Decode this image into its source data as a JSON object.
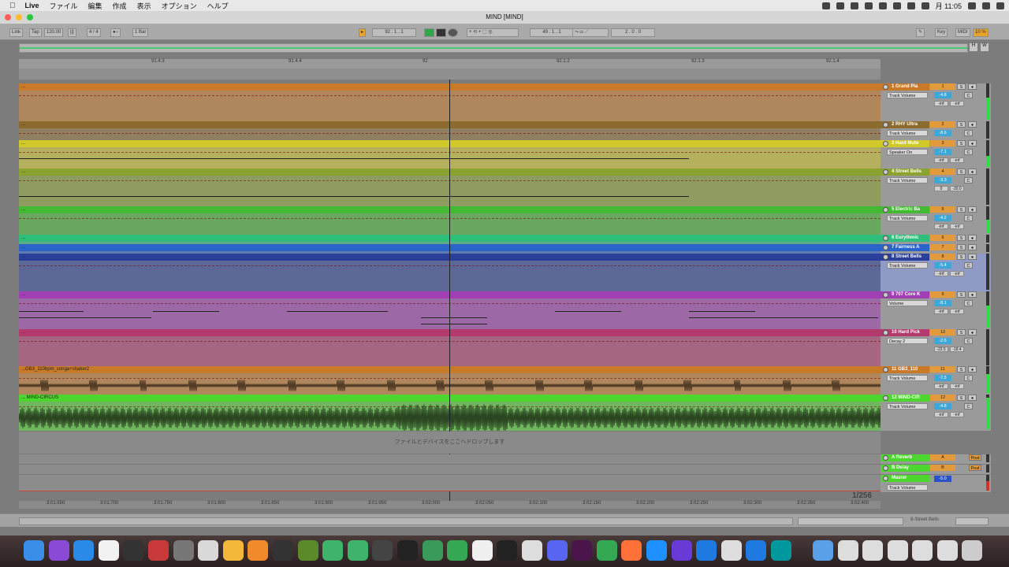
{
  "menubar": {
    "app": "Live",
    "items": [
      "ファイル",
      "編集",
      "作成",
      "表示",
      "オプション",
      "ヘルプ"
    ],
    "clock": "月 11:05"
  },
  "window": {
    "title": "MIND  [MIND]"
  },
  "controlbar": {
    "link": "Link",
    "tap": "Tap",
    "tempo": "120.00",
    "signature": "4 / 4",
    "quant": "1 Bar",
    "pos": "92 . 1 . 1",
    "loop_start": "49 . 1 . 1",
    "loop_len": "2 . 0 . 0",
    "key": "Key",
    "midi": "MIDI",
    "cpu": "10 %"
  },
  "ruler": {
    "ticks": [
      "91.4.3",
      "91.4.4",
      "92",
      "92.1.2",
      "92.1.3",
      "92.1.4"
    ]
  },
  "colors": {
    "accent_select": "#2a52c8",
    "meter": "#2edc46",
    "volume_field": "#3da8d8"
  },
  "tracks": [
    {
      "name": "1 Grand Pia",
      "num": "1",
      "chooser": "Track Volume",
      "vol": "-4.8",
      "inf1": "-inf",
      "inf2": "-inf",
      "color": "#c97a28",
      "clip": "...",
      "level": 0.6
    },
    {
      "name": "2 RHY Ultra",
      "num": "2",
      "chooser": "Track Volume",
      "vol": "-8.6",
      "inf1": "",
      "inf2": "",
      "color": "#8c6b2f",
      "clip": "...",
      "level": 0.0
    },
    {
      "name": "3 Hard Mute",
      "num": "3",
      "chooser": "Speaker On",
      "vol": "-7.1",
      "inf1": "-inf",
      "inf2": "-inf",
      "color": "#d1c92a",
      "clip": "...",
      "level": 0.4
    },
    {
      "name": "4 Street Bells",
      "num": "4",
      "chooser": "Track Volume",
      "vol": "-3.3",
      "inf1": "0",
      "inf2": "-20.0",
      "color": "#8aa230",
      "clip": "...",
      "level": 0.0
    },
    {
      "name": "5 Electric Ba",
      "num": "5",
      "chooser": "Track Volume",
      "vol": "-4.2",
      "inf1": "-inf",
      "inf2": "-inf",
      "color": "#44b933",
      "clip": "...",
      "level": 0.5
    },
    {
      "name": "6 Eurythmic",
      "num": "6",
      "chooser": "",
      "vol": "",
      "inf1": "",
      "inf2": "",
      "color": "#2fbf7c",
      "clip": "...",
      "level": 0.0
    },
    {
      "name": "7 Fairness A",
      "num": "7",
      "chooser": "",
      "vol": "",
      "inf1": "",
      "inf2": "",
      "color": "#2a64c8",
      "clip": "...",
      "level": 0.0
    },
    {
      "name": "8 Street Bells",
      "num": "8",
      "chooser": "Track Volume",
      "vol": "-5.4",
      "inf1": "-inf",
      "inf2": "-inf",
      "color": "#2a3f9a",
      "clip": "...",
      "level": 0.0
    },
    {
      "name": "9 707 Core K",
      "num": "9",
      "chooser": "Volume",
      "vol": "-8.1",
      "inf1": "-inf",
      "inf2": "-inf",
      "color": "#a23fb4",
      "clip": "...",
      "level": 0.6
    },
    {
      "name": "10 Hard Pick",
      "num": "10",
      "chooser": "Decay 2",
      "vol": "-2.6",
      "inf1": "-22.5",
      "inf2": "-18.4",
      "color": "#b43a6e",
      "clip": "...",
      "level": 0.0
    },
    {
      "name": "11 GB3_110",
      "num": "11",
      "chooser": "Track Volume",
      "vol": "-7.5",
      "inf1": "-inf",
      "inf2": "-inf",
      "color": "#c97a28",
      "clip": "...GB3_110bpm_conga+shaker2",
      "level": 0.7
    },
    {
      "name": "12 MIND-CIR",
      "num": "12",
      "chooser": "Track Volume",
      "vol": "-4.8",
      "inf1": "-inf",
      "inf2": "-inf",
      "color": "#4dd62e",
      "clip": "... MIND-CIRCUS",
      "level": 0.9
    }
  ],
  "dropzone": "ファイルとデバイスをここへドロップします",
  "returns": [
    {
      "name": "A Reverb",
      "num": "A",
      "btn": "Post",
      "color": "#4dd62e"
    },
    {
      "name": "B Delay",
      "num": "B",
      "btn": "Post",
      "color": "#4dd62e"
    },
    {
      "name": "Master",
      "num": "",
      "btn": "",
      "color": "#4dd62e",
      "chooser": "Track Volume",
      "vol": "-5.0",
      "vol2": "0"
    }
  ],
  "counter": "1/256",
  "status": {
    "track_name": "8-Street Bells"
  },
  "bottom_ruler": [
    "3:01:550",
    "3:01:700",
    "3:01:750",
    "3:01:800",
    "3:01:850",
    "3:01:900",
    "3:01:950",
    "3:02:000",
    "3:02:050",
    "3:02:100",
    "3:02:150",
    "3:02:200",
    "3:02:250",
    "3:02:300",
    "3:02:350",
    "3:02:400"
  ],
  "dock": [
    "Finder",
    "Siri",
    "App Store",
    "Calendar",
    "OBS",
    "Photo Booth",
    "Prefs",
    "Preview",
    "Photos",
    "Books",
    "Xcode",
    "Minecraft",
    "Live",
    "Live",
    "Live",
    "Resolve",
    "Logic",
    "Chrome",
    "Music",
    "Notes",
    "Folder",
    "Discord",
    "Slack",
    "Chrome",
    "Firefox",
    "Safari",
    "Star",
    "Edge",
    "Focus",
    "Teams",
    "Arduino",
    "Files",
    "Dock",
    "Dock",
    "Dock",
    "Dock",
    "Dock",
    "Trash"
  ]
}
